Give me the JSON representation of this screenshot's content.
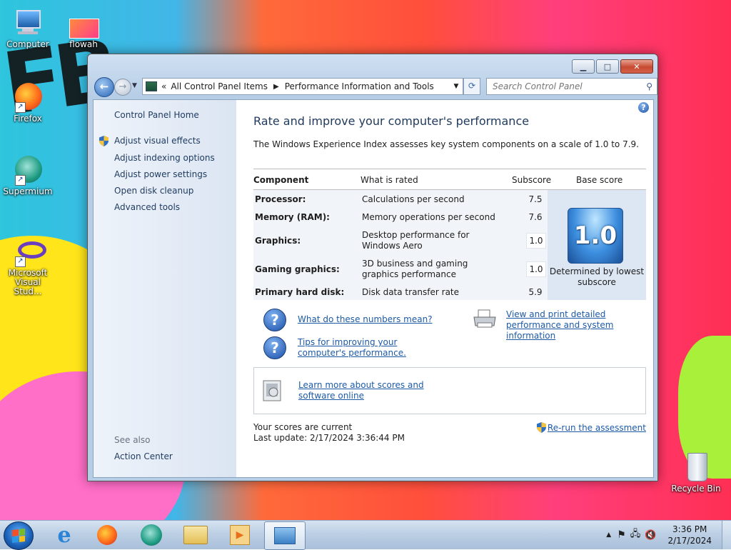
{
  "desktop": {
    "icons": [
      {
        "label": "Computer"
      },
      {
        "label": "flowah"
      },
      {
        "label": "Firefox"
      },
      {
        "label": "Supermium"
      },
      {
        "label": "Microsoft Visual Stud..."
      },
      {
        "label": "Recycle Bin"
      }
    ]
  },
  "window": {
    "address": {
      "history_glyph": "«",
      "crumbs": [
        "All Control Panel Items",
        "Performance Information and Tools"
      ]
    },
    "search_placeholder": "Search Control Panel",
    "left_pane": {
      "home": "Control Panel Home",
      "links": [
        "Adjust visual effects",
        "Adjust indexing options",
        "Adjust power settings",
        "Open disk cleanup",
        "Advanced tools"
      ],
      "see_also_heading": "See also",
      "see_also": [
        "Action Center"
      ]
    },
    "main": {
      "title": "Rate and improve your computer's performance",
      "description": "The Windows Experience Index assesses key system components on a scale of 1.0 to 7.9.",
      "headers": [
        "Component",
        "What is rated",
        "Subscore",
        "Base score"
      ],
      "rows": [
        {
          "component": "Processor:",
          "rated": "Calculations per second",
          "subscore": "7.5"
        },
        {
          "component": "Memory (RAM):",
          "rated": "Memory operations per second",
          "subscore": "7.6"
        },
        {
          "component": "Graphics:",
          "rated": "Desktop performance for Windows Aero",
          "subscore": "1.0"
        },
        {
          "component": "Gaming graphics:",
          "rated": "3D business and gaming graphics performance",
          "subscore": "1.0"
        },
        {
          "component": "Primary hard disk:",
          "rated": "Disk data transfer rate",
          "subscore": "5.9"
        }
      ],
      "base_score": "1.0",
      "base_note": "Determined by lowest subscore",
      "help_links": {
        "numbers": "What do these numbers mean?",
        "tips": "Tips for improving your computer's performance.",
        "print": "View and print detailed performance and system information"
      },
      "learn_more": "Learn more about scores and software online",
      "status_current": "Your scores are current",
      "last_update": "Last update: 2/17/2024 3:36:44 PM",
      "rerun": "Re-run the assessment"
    }
  },
  "taskbar": {
    "pinned": [
      "internet-explorer-icon",
      "firefox-icon",
      "supermium-icon",
      "windows-explorer-icon",
      "media-player-icon",
      "control-panel-icon"
    ],
    "clock_time": "3:36 PM",
    "clock_date": "2/17/2024"
  },
  "colors": {
    "link": "#1c5aa6",
    "heading": "#1e395b",
    "badge": "#3c8edf"
  }
}
